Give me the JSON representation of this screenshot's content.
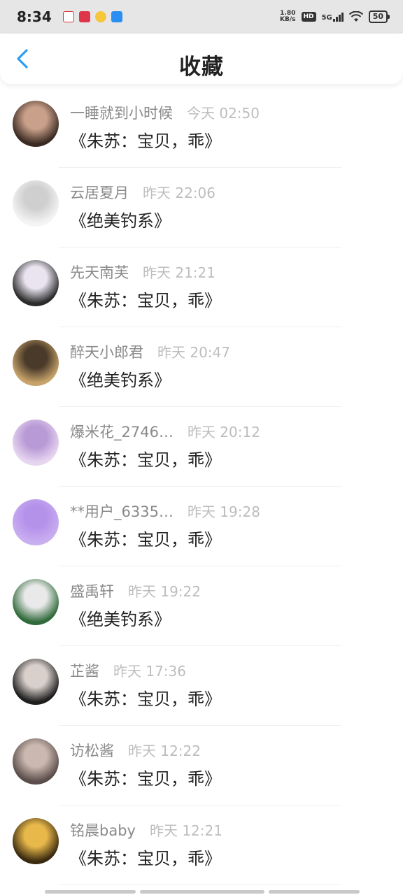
{
  "status_bar": {
    "time": "8:34",
    "speed_top": "1.80",
    "speed_bottom": "KB/s",
    "hd": "HD",
    "network": "5G",
    "battery": "50",
    "notification_icons": [
      "calendar-notification-icon",
      "app-notification-icon",
      "weibo-notification-icon",
      "app-notification-icon"
    ]
  },
  "header": {
    "title": "收藏",
    "back_icon": "chevron-left-icon",
    "accent_color": "#2a9df4"
  },
  "items": [
    {
      "name": "一睡就到小时候",
      "time": "今天 02:50",
      "content": "《朱苏：宝贝，乖》",
      "avatar_colors": [
        "#3a2a22",
        "#c9a08a"
      ]
    },
    {
      "name": "云居夏月",
      "time": "昨天 22:06",
      "content": "《绝美钓系》",
      "avatar_colors": [
        "#f4f4f4",
        "#cfcfcf"
      ]
    },
    {
      "name": "先天南芙",
      "time": "昨天 21:21",
      "content": "《朱苏：宝贝，乖》",
      "avatar_colors": [
        "#2b2b2b",
        "#e9e4f0"
      ]
    },
    {
      "name": "醉天小郎君",
      "time": "昨天 20:47",
      "content": "《绝美钓系》",
      "avatar_colors": [
        "#c8a46a",
        "#4a3a2a"
      ]
    },
    {
      "name": "爆米花_2746…",
      "time": "昨天 20:12",
      "content": "《朱苏：宝贝，乖》",
      "avatar_colors": [
        "#e8d6f0",
        "#b89ad6"
      ]
    },
    {
      "name": "**用户_6335…",
      "time": "昨天 19:28",
      "content": "《朱苏：宝贝，乖》",
      "avatar_colors": [
        "#c9aef0",
        "#b592ea"
      ]
    },
    {
      "name": "盛禹轩",
      "time": "昨天 19:22",
      "content": "《绝美钓系》",
      "avatar_colors": [
        "#2f6a3a",
        "#e9e9e9"
      ]
    },
    {
      "name": "芷酱",
      "time": "昨天 17:36",
      "content": "《朱苏：宝贝，乖》",
      "avatar_colors": [
        "#1e1e1e",
        "#d9d0cc"
      ]
    },
    {
      "name": "访松酱",
      "time": "昨天 12:22",
      "content": "《朱苏：宝贝，乖》",
      "avatar_colors": [
        "#5a4d4a",
        "#cbb8b0"
      ]
    },
    {
      "name": "铭晨baby",
      "time": "昨天 12:21",
      "content": "《朱苏：宝贝，乖》",
      "avatar_colors": [
        "#3a2a10",
        "#e8b84a"
      ]
    }
  ]
}
